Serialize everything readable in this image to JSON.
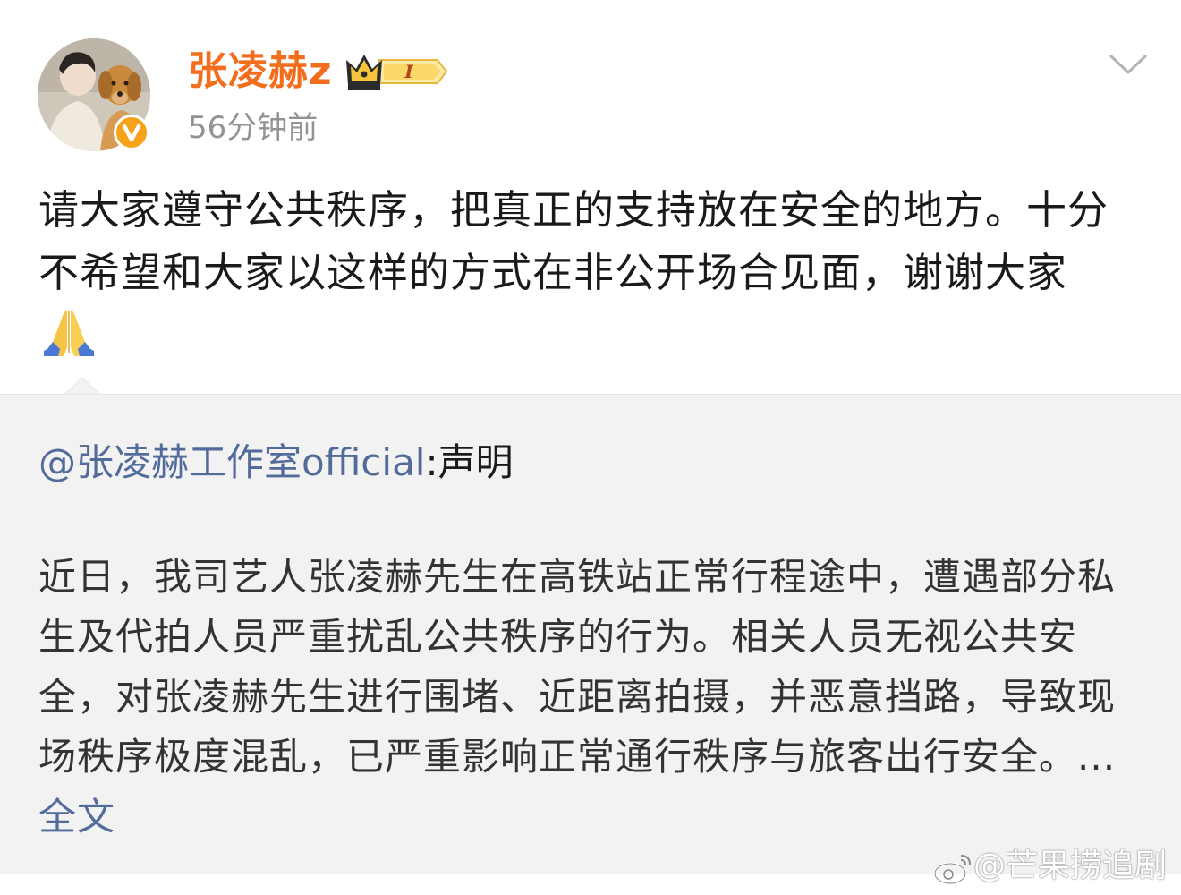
{
  "post": {
    "author": "张凌赫z",
    "vip_level": "I",
    "time": "56分钟前",
    "text": "请大家遵守公共秩序，把真正的支持放在安全的地方。十分不希望和大家以这样的方式在非公开场合见面，谢谢大家",
    "emoji": "folded-hands-icon"
  },
  "repost": {
    "mention": "@张凌赫工作室official",
    "title": ":声明",
    "text": "近日，我司艺人张凌赫先生在高铁站正常行程途中，遭遇部分私生及代拍人员严重扰乱公共秩序的行为。相关人员无视公共安全，对张凌赫先生进行围堵、近距离拍摄，并恶意挡路，导致现场秩序极度混乱，已严重影响正常通行秩序与旅客出行安全。",
    "ellipsis": "... ",
    "full_text_link": "全文"
  },
  "watermark": {
    "text": "@芒果捞追剧"
  },
  "colors": {
    "username": "#f26d1c",
    "link": "#526b9a",
    "timestamp": "#939393",
    "repost_bg": "#f2f2f2",
    "badge": "#f7a21b"
  }
}
